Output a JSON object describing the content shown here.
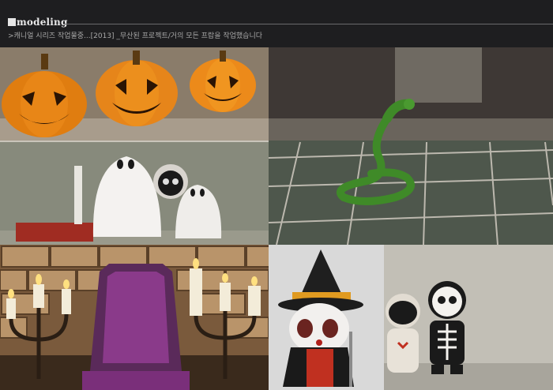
{
  "header": {
    "title": "modeling",
    "subtitle": ">캐니얼 시리즈 작업물중...[2013] _무산된 프로젝트/거의 모든 프랍을 작업했습니다"
  },
  "gallery": {
    "images": [
      {
        "subject": "jack-o-lantern-pumpkins-and-ghosts-render"
      },
      {
        "subject": "green-snake-on-tile-floor-render"
      },
      {
        "subject": "candles-and-purple-throne-render"
      },
      {
        "subject": "witch-character-and-skeleton-toys-render"
      }
    ]
  },
  "colors": {
    "header_bg": "#1e1e20",
    "title": "#e8e8e8",
    "subtitle": "#a8a8a8",
    "rule": "#6a6a6c"
  }
}
